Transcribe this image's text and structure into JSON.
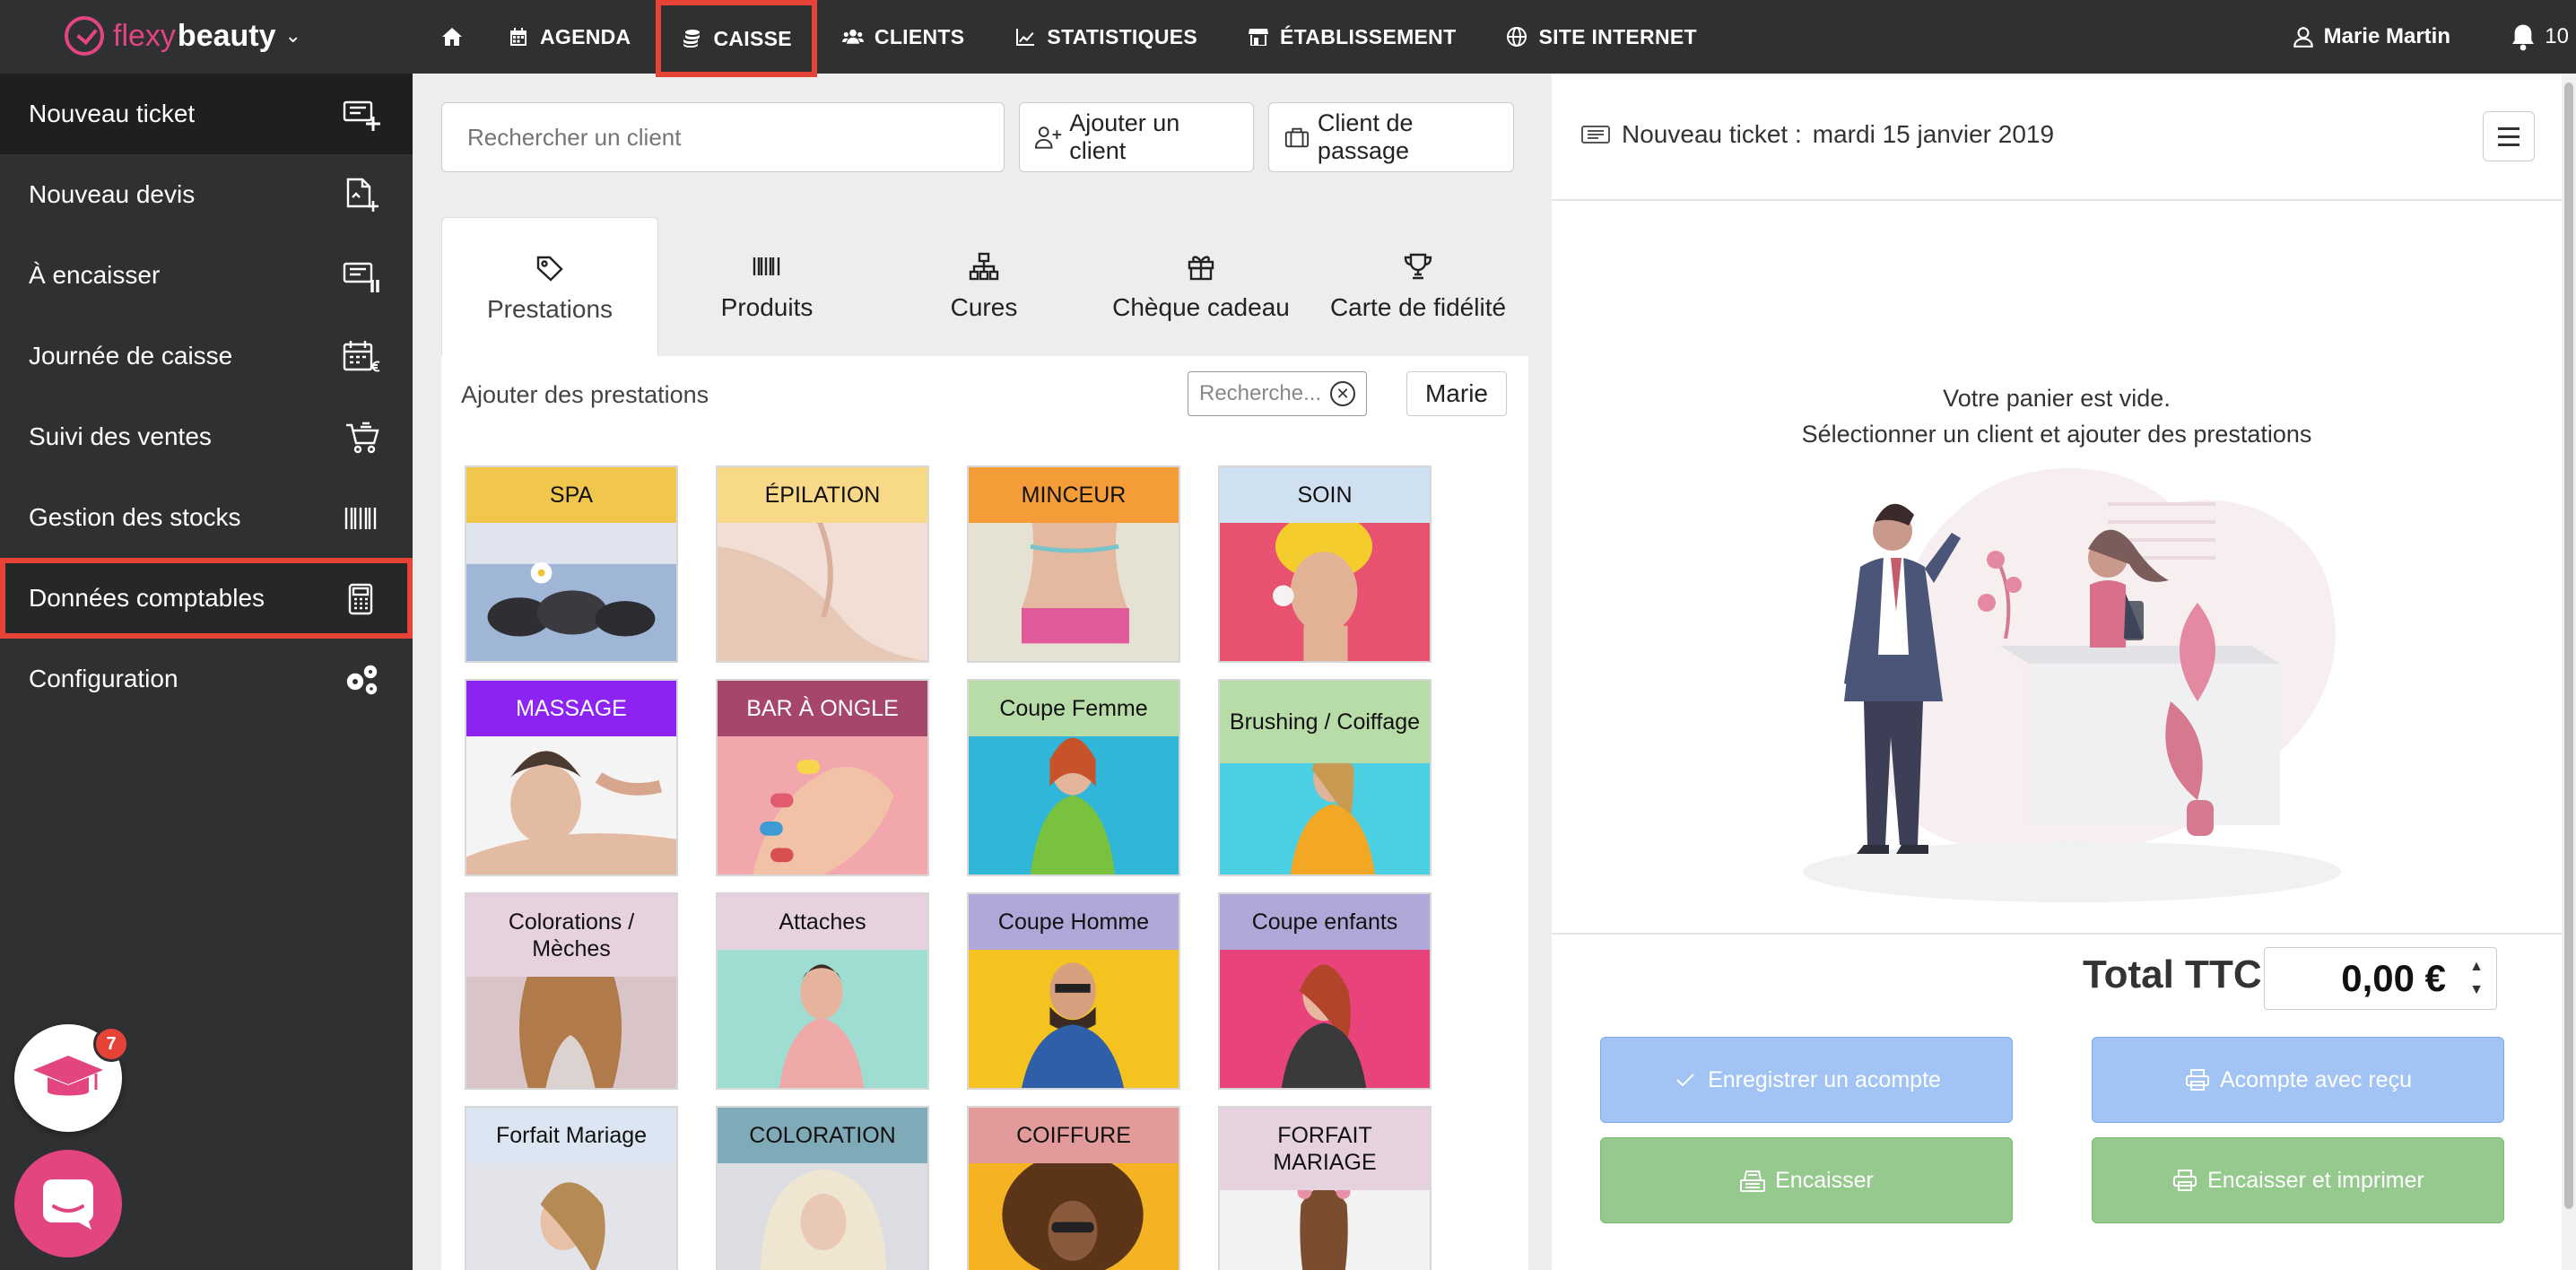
{
  "brand": {
    "name_part1": "flexy",
    "name_part2": "beauty",
    "caret": "⌄"
  },
  "nav": {
    "home_icon": "home-icon",
    "items": [
      {
        "label": "AGENDA",
        "icon": "calendar-icon"
      },
      {
        "label": "CAISSE",
        "icon": "coins-icon",
        "active": true
      },
      {
        "label": "CLIENTS",
        "icon": "users-icon"
      },
      {
        "label": "STATISTIQUES",
        "icon": "chart-icon"
      },
      {
        "label": "ÉTABLISSEMENT",
        "icon": "store-icon"
      },
      {
        "label": "SITE INTERNET",
        "icon": "globe-icon"
      }
    ],
    "user_name": "Marie Martin",
    "notifications": "10"
  },
  "sidebar": {
    "items": [
      {
        "label": "Nouveau ticket",
        "icon": "ticket-plus-icon"
      },
      {
        "label": "Nouveau devis",
        "icon": "document-plus-icon"
      },
      {
        "label": "À encaisser",
        "icon": "ticket-pause-icon"
      },
      {
        "label": "Journée de caisse",
        "icon": "calendar-euro-icon"
      },
      {
        "label": "Suivi des ventes",
        "icon": "cart-icon"
      },
      {
        "label": "Gestion des stocks",
        "icon": "barcode-icon"
      },
      {
        "label": "Données comptables",
        "icon": "calculator-icon",
        "highlighted": true
      },
      {
        "label": "Configuration",
        "icon": "gears-icon"
      }
    ],
    "help_badge": "7"
  },
  "client": {
    "search_placeholder": "Rechercher un client",
    "add_client": "Ajouter un client",
    "walk_in": "Client de passage"
  },
  "tabs": [
    {
      "label": "Prestations",
      "icon": "tag-icon",
      "active": true
    },
    {
      "label": "Produits",
      "icon": "barcode-icon"
    },
    {
      "label": "Cures",
      "icon": "sitemap-icon"
    },
    {
      "label": "Chèque cadeau",
      "icon": "gift-icon"
    },
    {
      "label": "Carte de fidélité",
      "icon": "trophy-icon"
    }
  ],
  "services": {
    "add_label": "Ajouter des prestations",
    "search_placeholder": "Recherche...",
    "staff": "Marie",
    "categories": [
      {
        "label": "SPA",
        "color": "#f0c64d",
        "pic": "stones"
      },
      {
        "label": "ÉPILATION",
        "color": "#f8d987",
        "pic": "skin"
      },
      {
        "label": "MINCEUR",
        "color": "#f39c38",
        "pic": "waist"
      },
      {
        "label": "SOIN",
        "color": "#cfe0f0",
        "pic": "towel"
      },
      {
        "label": "MASSAGE",
        "color": "#8c23f2",
        "pic": "massage",
        "light_text": true
      },
      {
        "label": "BAR À ONGLE",
        "color": "#a6466a",
        "pic": "nails",
        "light_text": true
      },
      {
        "label": "Coupe Femme",
        "color": "#b8dca7",
        "pic": "woman-blue"
      },
      {
        "label": "Brushing / Coiffage",
        "color": "#b8dca7",
        "pic": "woman-cyan"
      },
      {
        "label": "Colorations / Mèches",
        "color": "#e6d1de",
        "pic": "curls"
      },
      {
        "label": "Attaches",
        "color": "#e6d1de",
        "pic": "mint"
      },
      {
        "label": "Coupe Homme",
        "color": "#b1a6d8",
        "pic": "man-yellow"
      },
      {
        "label": "Coupe enfants",
        "color": "#b1a6d8",
        "pic": "girl-pink"
      },
      {
        "label": "Forfait Mariage",
        "color": "#dbe6f2",
        "pic": "braid"
      },
      {
        "label": "COLORATION",
        "color": "#7faab8",
        "pic": "blonde"
      },
      {
        "label": "COIFFURE",
        "color": "#e29a9a",
        "pic": "afro"
      },
      {
        "label": "FORFAIT MARIAGE",
        "color": "#e6d1de",
        "pic": "flowers"
      }
    ]
  },
  "ticket": {
    "title": "Nouveau ticket :",
    "date": "mardi 15 janvier 2019",
    "empty_line1": "Votre panier est vide.",
    "empty_line2": "Sélectionner un client et ajouter des prestations",
    "total_label": "Total TTC",
    "total_value": "0,00 €",
    "btn_deposit": "Enregistrer un acompte",
    "btn_deposit_receipt": "Acompte avec reçu",
    "btn_cash_in": "Encaisser",
    "btn_cash_in_print": "Encaisser et imprimer"
  },
  "colors": {
    "accent": "#e2457f",
    "highlight": "#e64237",
    "dark": "#2f3032",
    "blue_btn": "#a2c4f4",
    "green_btn": "#96c98e"
  }
}
